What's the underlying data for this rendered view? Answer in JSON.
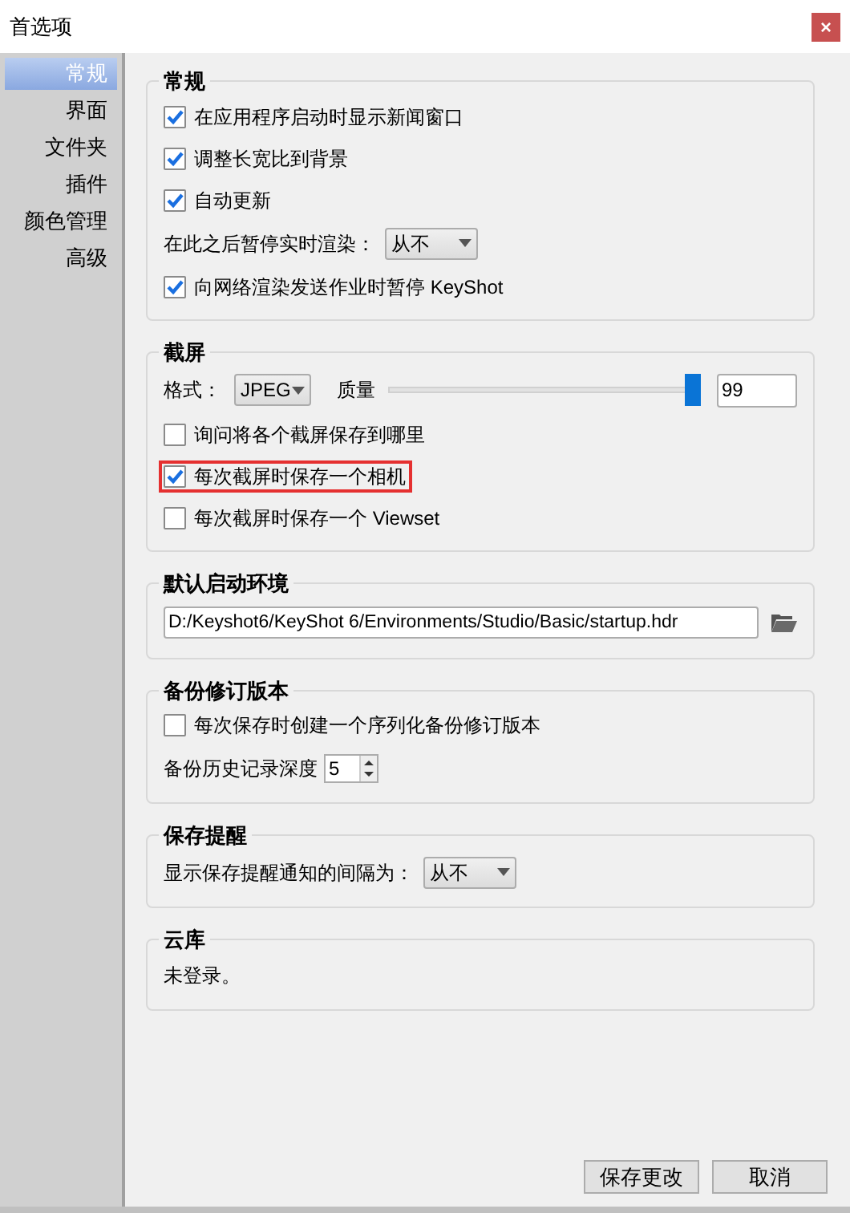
{
  "window": {
    "title": "首选项",
    "close": "×"
  },
  "sidebar": {
    "items": [
      {
        "label": "常规",
        "selected": true
      },
      {
        "label": "界面",
        "selected": false
      },
      {
        "label": "文件夹",
        "selected": false
      },
      {
        "label": "插件",
        "selected": false
      },
      {
        "label": "颜色管理",
        "selected": false
      },
      {
        "label": "高级",
        "selected": false
      }
    ]
  },
  "sections": [
    {
      "title": "常规",
      "rows": [
        {
          "kind": "checkbox",
          "label": "在应用程序启动时显示新闻窗口",
          "checked": true
        },
        {
          "kind": "checkbox",
          "label": "调整长宽比到背景",
          "checked": true
        },
        {
          "kind": "checkbox",
          "label": "自动更新",
          "checked": true
        },
        {
          "kind": "dropdown",
          "label": "在此之后暂停实时渲染：",
          "value": "从不"
        },
        {
          "kind": "checkbox",
          "label": "向网络渲染发送作业时暂停 KeyShot",
          "checked": true
        }
      ]
    },
    {
      "title": "截屏",
      "rows": [
        {
          "kind": "quality",
          "label": "格式：",
          "format": "JPEG",
          "quality_label": "质量",
          "level": 0.99,
          "value": "99"
        },
        {
          "kind": "checkbox",
          "label": "询问将各个截屏保存到哪里",
          "checked": false
        },
        {
          "kind": "checkbox",
          "label": "每次截屏时保存一个相机",
          "checked": true,
          "highlighted": true
        },
        {
          "kind": "checkbox",
          "label": "每次截屏时保存一个 Viewset",
          "checked": false
        }
      ]
    },
    {
      "title": "默认启动环境",
      "rows": [
        {
          "kind": "path",
          "value": "D:/Keyshot6/KeyShot 6/Environments/Studio/Basic/startup.hdr"
        }
      ]
    },
    {
      "title": "备份修订版本",
      "rows": [
        {
          "kind": "checkbox",
          "label": "每次保存时创建一个序列化备份修订版本",
          "checked": false
        },
        {
          "kind": "spinner",
          "label": "备份历史记录深度",
          "value": "5"
        }
      ]
    },
    {
      "title": "保存提醒",
      "rows": [
        {
          "kind": "dropdown",
          "label": "显示保存提醒通知的间隔为：",
          "value": "从不"
        }
      ]
    },
    {
      "title": "云库",
      "rows": [
        {
          "kind": "text",
          "label": "未登录。"
        }
      ]
    }
  ],
  "buttons": [
    "保存更改",
    "取消"
  ]
}
